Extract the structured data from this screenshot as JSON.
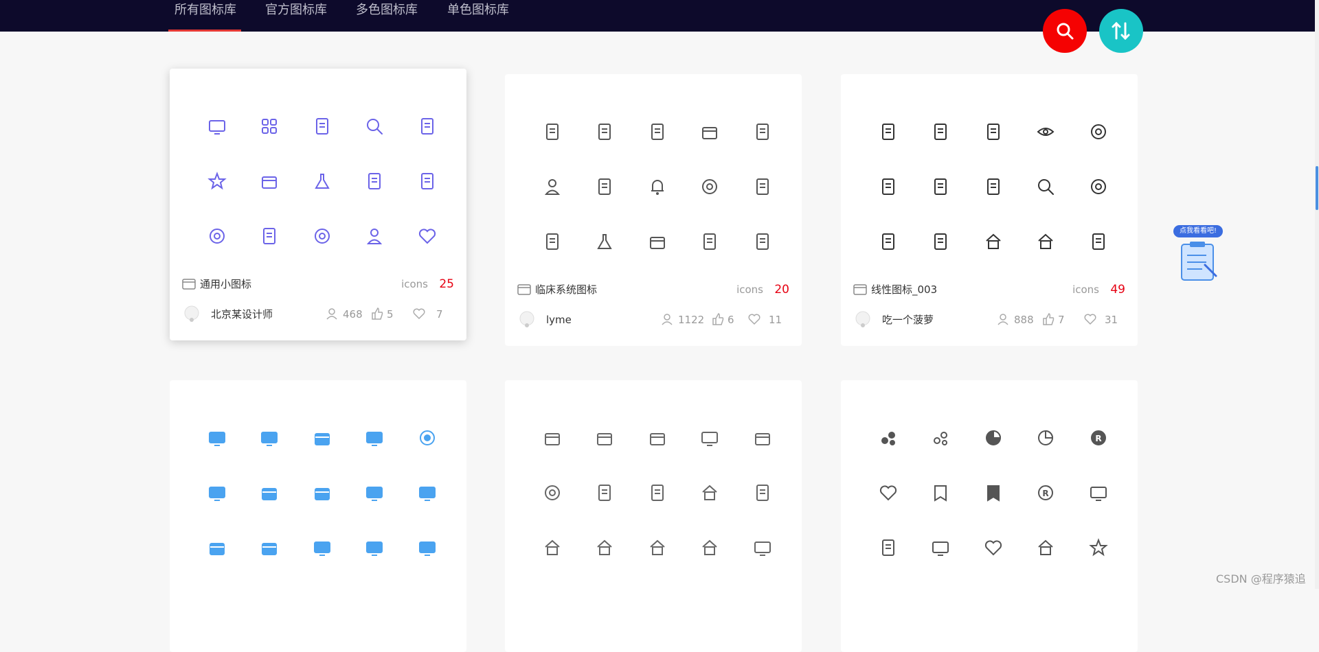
{
  "nav": {
    "tabs": [
      {
        "label": "所有图标库",
        "active": true
      },
      {
        "label": "官方图标库",
        "active": false
      },
      {
        "label": "多色图标库",
        "active": false
      },
      {
        "label": "单色图标库",
        "active": false
      }
    ]
  },
  "buttons": {
    "search_icon": "search-icon",
    "sort_icon": "sort-icon"
  },
  "promo": {
    "label": "点我看看吧!"
  },
  "cards": [
    {
      "title": "通用小图标",
      "icons_label": "icons",
      "icon_count": "25",
      "author": "北京某设计师",
      "users": "468",
      "likes": "5",
      "favorites": "7",
      "icon_color": "#6b63e8",
      "icons": [
        "monitor-icon",
        "grid-icon",
        "folder-icon",
        "search-icon",
        "document-icon",
        "star-icon",
        "briefcase-icon",
        "flask-icon",
        "book-icon",
        "wrench-icon",
        "badge-icon",
        "building-icon",
        "yen-icon",
        "user-icon",
        "heart-icon"
      ]
    },
    {
      "title": "临床系统图标",
      "icons_label": "icons",
      "icon_count": "20",
      "author": "lyme",
      "users": "1122",
      "likes": "6",
      "favorites": "11",
      "icon_color": "#555555",
      "icons": [
        "microscope-icon",
        "calendar-chart-icon",
        "report-icon",
        "bag-plus-icon",
        "document-plus-icon",
        "nurse-icon",
        "scalpel-icon",
        "bell-icon",
        "device-icon",
        "list-icon",
        "schedule-icon",
        "flask-icon",
        "medicine-jar-icon",
        "link-icon",
        "alarm-icon"
      ]
    },
    {
      "title": "线性图标_003",
      "icons_label": "icons",
      "icon_count": "49",
      "author": "吃一个菠萝",
      "users": "888",
      "likes": "7",
      "favorites": "31",
      "icon_color": "#333333",
      "icons": [
        "phone-icon",
        "shield-check-icon",
        "tag-icon",
        "eye-icon",
        "compass-icon",
        "document-icon",
        "thumb-up-icon",
        "file-icon",
        "search-icon",
        "navigation-icon",
        "id-card-icon",
        "headset-icon",
        "crown-icon",
        "shop-icon",
        "copy-icon"
      ]
    },
    {
      "title": "",
      "icons_label": "",
      "icon_count": "",
      "author": "",
      "users": "",
      "likes": "",
      "favorites": "",
      "icon_color": "#4aa3f0",
      "icons": [
        "monitor-icon",
        "video-icon",
        "archive-icon",
        "video-camera-icon",
        "target-icon",
        "tv-play-icon",
        "archive-down-icon",
        "archive-up-icon",
        "presentation-icon",
        "screen-icon",
        "lock-box-icon",
        "list-box-icon",
        "projector-icon",
        "display-icon",
        "tv-icon"
      ]
    },
    {
      "title": "",
      "icons_label": "",
      "icon_count": "",
      "author": "",
      "users": "",
      "likes": "",
      "favorites": "",
      "icon_color": "#666666",
      "icons": [
        "wallet-icon",
        "truck-icon",
        "gift-icon",
        "chart-board-icon",
        "box-icon",
        "link-circle-icon",
        "ai-icon",
        "tag-card-icon",
        "store-refresh-icon",
        "building-data-icon",
        "shop-front-icon",
        "tower-icon",
        "home-location-icon",
        "home-icon",
        "tv-play-icon"
      ]
    },
    {
      "title": "",
      "icons_label": "",
      "icon_count": "",
      "author": "",
      "users": "",
      "likes": "",
      "favorites": "",
      "icon_color": "#555555",
      "icons": [
        "bubbles-icon",
        "bubbles-outline-icon",
        "pie-chart-icon",
        "pie-outline-icon",
        "registered-icon",
        "heart-handshake-icon",
        "banner-icon",
        "banner-filled-icon",
        "registered-outline-icon",
        "presentation-play-icon",
        "clipboard-play-icon",
        "video-board-icon",
        "heart-link-icon",
        "pavilion-icon",
        "bookmark-star-icon"
      ]
    }
  ],
  "watermark": "CSDN @程序猿追"
}
